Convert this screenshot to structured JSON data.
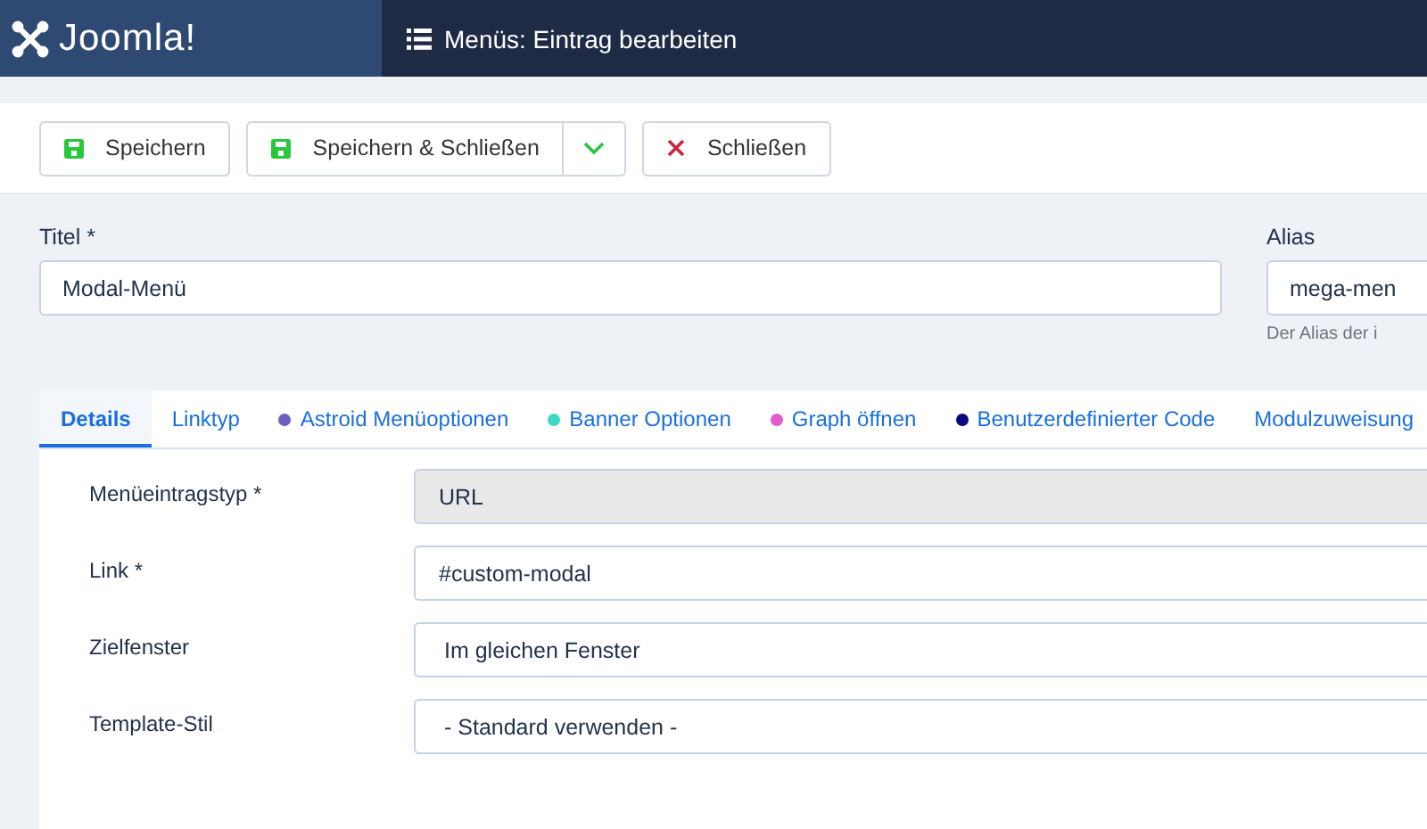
{
  "header": {
    "logo": "Joomla!",
    "title": "Menüs: Eintrag bearbeiten"
  },
  "toolbar": [
    {
      "label": "Speichern",
      "kind": "save"
    },
    {
      "label": "Speichern & Schließen",
      "kind": "save-dropdown"
    },
    {
      "label": "Schließen",
      "kind": "close"
    }
  ],
  "title_field": {
    "label": "Titel *",
    "value": "Modal-Menü"
  },
  "alias_field": {
    "label": "Alias",
    "value": "mega-men",
    "hint": "Der Alias der i"
  },
  "tabs": [
    {
      "label": "Details",
      "selected": true
    },
    {
      "label": "Linktyp",
      "selected": false
    },
    {
      "label": "Astroid Menüoptionen",
      "selected": false,
      "color": "#6a5fc0"
    },
    {
      "label": "Banner Optionen",
      "selected": false,
      "color": "#3ed6c8"
    },
    {
      "label": "Graph öffnen",
      "selected": false,
      "color": "#e25ccc"
    },
    {
      "label": "Benutzerdefinierter Code",
      "selected": false,
      "color": "#0a0a80"
    },
    {
      "label": "Modulzuweisung",
      "selected": false
    }
  ],
  "fields": [
    {
      "label": "Menüeintragstyp *",
      "value": "URL",
      "kind": "readonly"
    },
    {
      "label": "Link *",
      "value": "#custom-modal",
      "kind": "text"
    },
    {
      "label": "Zielfenster",
      "value": "Im gleichen Fenster",
      "kind": "select"
    },
    {
      "label": "Template-Stil",
      "value": "- Standard verwenden -",
      "kind": "select"
    }
  ]
}
